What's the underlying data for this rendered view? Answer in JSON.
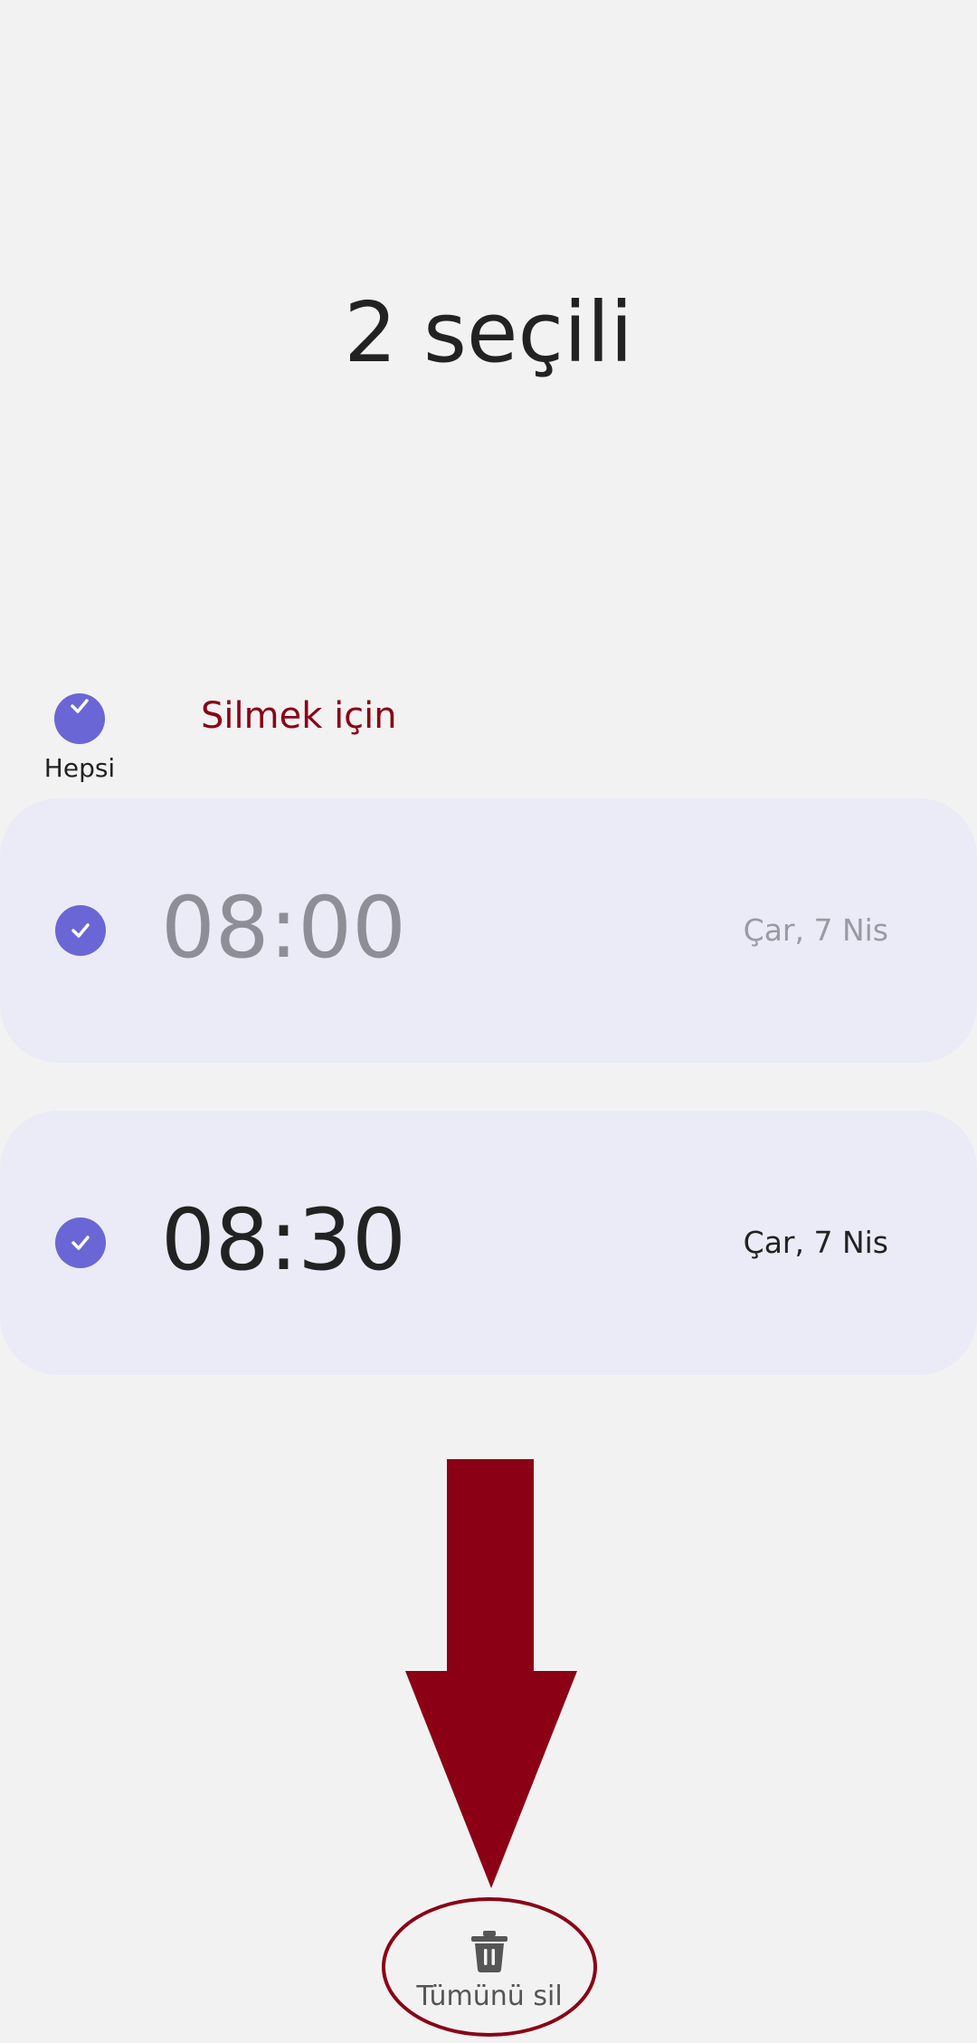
{
  "header": {
    "title": "2 seçili"
  },
  "select_all": {
    "label": "Hepsi",
    "checked": true
  },
  "annotation": {
    "text": "Silmek için",
    "color": "#8b0015"
  },
  "alarms": [
    {
      "time": "08:00",
      "date": "Çar, 7 Nis",
      "checked": true,
      "enabled": false
    },
    {
      "time": "08:30",
      "date": "Çar, 7 Nis",
      "checked": true,
      "enabled": true
    }
  ],
  "bottom_bar": {
    "delete_all_label": "Tümünü sil",
    "icon": "trash-icon"
  },
  "colors": {
    "accent": "#6a66d6",
    "card_background": "#ebebf8",
    "page_background": "#f2f2f2",
    "annotation": "#8b0015"
  }
}
